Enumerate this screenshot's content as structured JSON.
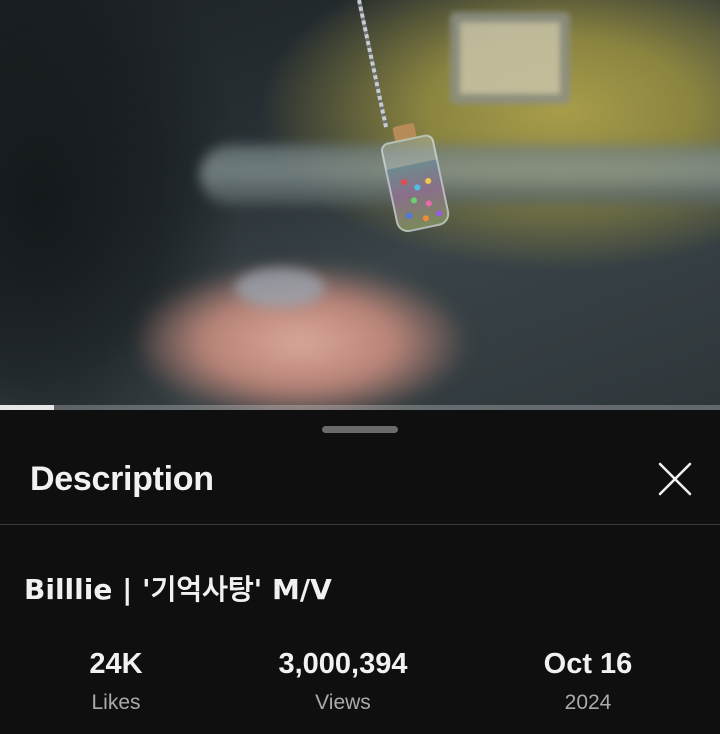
{
  "video": {
    "progress_fraction": 0.075
  },
  "description_panel": {
    "header_title": "Description",
    "close_icon": "close-icon",
    "video_title": "Billlie | '기억사탕' M/V",
    "stats": [
      {
        "value": "24K",
        "label": "Likes"
      },
      {
        "value": "3,000,394",
        "label": "Views"
      },
      {
        "value": "Oct 16",
        "label": "2024"
      }
    ]
  },
  "colors": {
    "background": "#0f0f0f",
    "primary_text": "#f1f1f1",
    "secondary_text": "#aaaaaa",
    "divider": "#3a3a3a"
  }
}
